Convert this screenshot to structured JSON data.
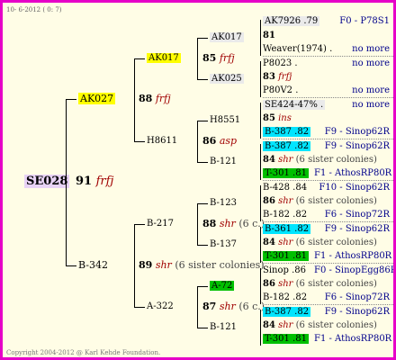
{
  "header": {
    "date": "10- 6-2012 ( 0: 7)"
  },
  "root": {
    "id": "SE028",
    "score": "91",
    "race": "frfj"
  },
  "gen1": [
    {
      "id": "AK027",
      "score": "88",
      "race": "frfj"
    },
    {
      "id": "B-342",
      "score": "89",
      "race": "shr",
      "sisters": "(6 sister colonies)"
    }
  ],
  "gen2": [
    {
      "id": "AK017",
      "score": "85",
      "race": "frfj"
    },
    {
      "id": "H8611",
      "score": "86",
      "race": "asp"
    },
    {
      "id": "B-217",
      "score": "88",
      "race": "shr",
      "sisters": "(6 c.)"
    },
    {
      "id": "A-322",
      "score": "87",
      "race": "shr",
      "sisters": "(6 c.)"
    }
  ],
  "gen3": [
    {
      "id": "AK017"
    },
    {
      "id": "AK025"
    },
    {
      "id": "H8551"
    },
    {
      "id": "B-121"
    },
    {
      "id": "B-123"
    },
    {
      "id": "B-137"
    },
    {
      "id": "A-72"
    },
    {
      "id": "B-121"
    }
  ],
  "gen4": [
    {
      "top": "AK7926 .79",
      "score": "81",
      "race": "",
      "sisters": "",
      "bottom": "Weaver(1974) .",
      "tag1": "F0 - P78S1",
      "tag2": "no more"
    },
    {
      "top": "P8023 .",
      "score": "83",
      "race": "frfj",
      "sisters": "",
      "bottom": "P80V2 .",
      "tag1": "no more",
      "tag2": "no more"
    },
    {
      "top": "SE424-47% .",
      "score": "85",
      "race": "ins",
      "sisters": "",
      "bottom": "B-387 .82",
      "tag1": "no more",
      "tag2": "F9 - Sinop62R"
    },
    {
      "top": "B-387 .82",
      "score": "84",
      "race": "shr",
      "sisters": "(6 sister colonies)",
      "bottom": "T-301 .81",
      "tag1": "F9 - Sinop62R",
      "tag2": "F1 - AthosRP80R"
    },
    {
      "top": "B-428 .84",
      "score": "86",
      "race": "shr",
      "sisters": "(6 sister colonies)",
      "bottom": "B-182 .82",
      "tag1": "F10 - Sinop62R",
      "tag2": "F6 - Sinop72R"
    },
    {
      "top": "B-361 .82",
      "score": "84",
      "race": "shr",
      "sisters": "(6 sister colonies)",
      "bottom": "T-301 .81",
      "tag1": "F9 - Sinop62R",
      "tag2": "F1 - AthosRP80R"
    },
    {
      "top": "Sinop .86",
      "score": "86",
      "race": "shr",
      "sisters": "(6 sister colonies)",
      "bottom": "B-182 .82",
      "tag1": "F0 - SinopEgg86R",
      "tag2": "F6 - Sinop72R"
    },
    {
      "top": "B-387 .82",
      "score": "84",
      "race": "shr",
      "sisters": "(6 sister colonies)",
      "bottom": "T-301 .81",
      "tag1": "F9 - Sinop62R",
      "tag2": "F1 - AthosRP80R"
    }
  ],
  "footer": {
    "copyright": "Copyright 2004-2012 @ Karl Kehde Foundation."
  }
}
